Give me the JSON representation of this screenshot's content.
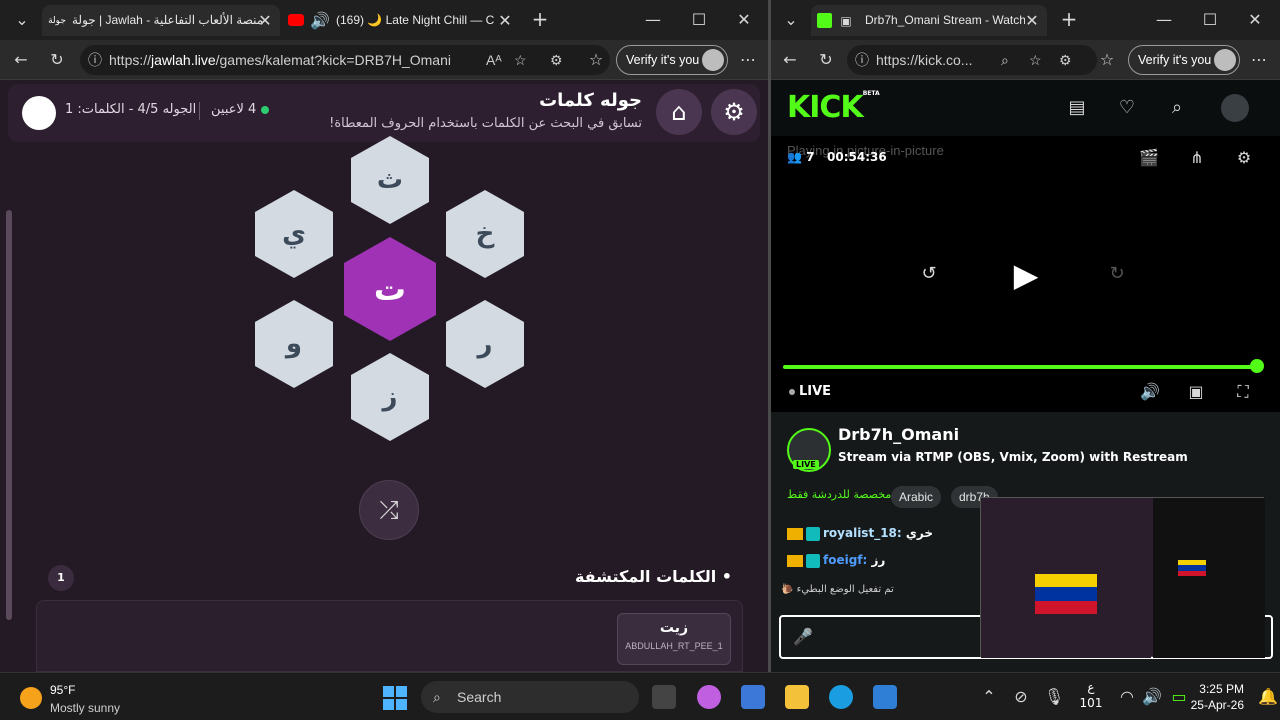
{
  "left_browser": {
    "tabs": [
      {
        "title": "جولة | Jawlah - منصة الألعاب التفاعلية"
      },
      {
        "title": "(169) 🌙 Late Night Chill — C"
      }
    ],
    "url_prefix": "https://",
    "url_domain": "jawlah.live",
    "url_path": "/games/kalemat?kick=DRB7H_Omani",
    "verify_label": "Verify it's you"
  },
  "game": {
    "title": "جوله كلمات",
    "subtitle": "تسابق في البحث عن الكلمات باستخدام الحروف المعطاة!",
    "players": "4 لاعبين",
    "round_info": "الجوله 4/5 - الكلمات: 1",
    "letters": {
      "top": "ث",
      "top_left": "ي",
      "top_right": "خ",
      "center": "ت",
      "bottom_left": "و",
      "bottom_right": "ر",
      "bottom": "ز"
    },
    "found_title": "الكلمات المكتشفة",
    "found_count": "1",
    "found_words": [
      {
        "word": "زيت",
        "user": "ABDULLAH_RT_PEE_1"
      }
    ]
  },
  "right_browser": {
    "tab_title": "Drb7h_Omani Stream - Watch",
    "url": "https://kick.co...",
    "verify_label": "Verify it's you"
  },
  "kick": {
    "logo": "KICK",
    "logo_sup": "BETA",
    "pip_text": "Playing in picture-in-picture",
    "viewers": "7",
    "time": "00:54:36",
    "live_label": "LIVE",
    "progress": 1.0,
    "channel_name": "Drb7h_Omani",
    "stream_title": "Stream via RTMP (OBS, Vmix, Zoom) with Restream",
    "live_badge": "LIVE",
    "category": "مخصصة للدردشة فقط",
    "tags": [
      "Arabic",
      "drb7h"
    ],
    "chat": [
      {
        "user": "royalist_18:",
        "text": "خري",
        "user_color": "#b3e0ff"
      },
      {
        "user": "foeigf:",
        "text": "رز",
        "user_color": "#4f9cff"
      }
    ],
    "system_message": "تم تفعيل الوضع البطيء"
  },
  "taskbar": {
    "temp": "95°F",
    "condition": "Mostly sunny",
    "search_placeholder": "Search",
    "lang": "ع",
    "lang_sub": "101",
    "time": "3:25 PM",
    "date": "25-Apr-26"
  },
  "colors": {
    "accent_purple": "#a033b5",
    "kick_green": "#53fc18"
  }
}
